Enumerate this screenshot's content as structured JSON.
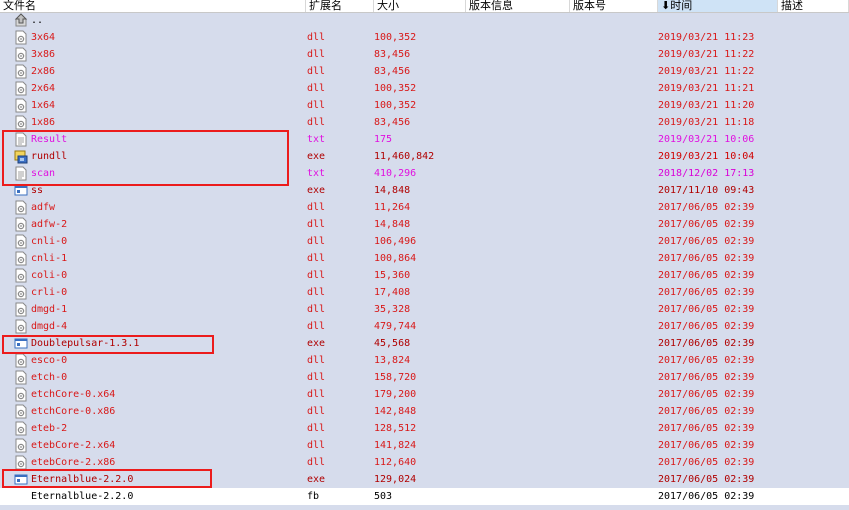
{
  "columns": {
    "name": "文件名",
    "ext": "扩展名",
    "size": "大小",
    "verinfo": "版本信息",
    "version": "版本号",
    "time": "⬇时间",
    "desc": "描述"
  },
  "rows": [
    {
      "name": "..",
      "ext": "",
      "size": "",
      "date": "",
      "type": "up",
      "icon": "up-folder-icon"
    },
    {
      "name": "3x64",
      "ext": "dll",
      "size": "100,352",
      "date": "2019/03/21 11:23",
      "type": "dll",
      "icon": "dll-file-icon"
    },
    {
      "name": "3x86",
      "ext": "dll",
      "size": "83,456",
      "date": "2019/03/21 11:22",
      "type": "dll",
      "icon": "dll-file-icon"
    },
    {
      "name": "2x86",
      "ext": "dll",
      "size": "83,456",
      "date": "2019/03/21 11:22",
      "type": "dll",
      "icon": "dll-file-icon"
    },
    {
      "name": "2x64",
      "ext": "dll",
      "size": "100,352",
      "date": "2019/03/21 11:21",
      "type": "dll",
      "icon": "dll-file-icon"
    },
    {
      "name": "1x64",
      "ext": "dll",
      "size": "100,352",
      "date": "2019/03/21 11:20",
      "type": "dll",
      "icon": "dll-file-icon"
    },
    {
      "name": "1x86",
      "ext": "dll",
      "size": "83,456",
      "date": "2019/03/21 11:18",
      "type": "dll",
      "icon": "dll-file-icon"
    },
    {
      "name": "Result",
      "ext": "txt",
      "size": "175",
      "date": "2019/03/21 10:06",
      "type": "txt",
      "icon": "text-file-icon"
    },
    {
      "name": "rundll",
      "ext": "exe",
      "size": "11,460,842",
      "date": "2019/03/21 10:04",
      "type": "exe-recent",
      "icon": "package-exe-icon"
    },
    {
      "name": "scan",
      "ext": "txt",
      "size": "410,296",
      "date": "2018/12/02 17:13",
      "type": "txt",
      "icon": "text-file-icon"
    },
    {
      "name": "ss",
      "ext": "exe",
      "size": "14,848",
      "date": "2017/11/10 09:43",
      "type": "exe",
      "icon": "exe-window-icon"
    },
    {
      "name": "adfw",
      "ext": "dll",
      "size": "11,264",
      "date": "2017/06/05 02:39",
      "type": "dll",
      "icon": "dll-file-icon"
    },
    {
      "name": "adfw-2",
      "ext": "dll",
      "size": "14,848",
      "date": "2017/06/05 02:39",
      "type": "dll",
      "icon": "dll-file-icon"
    },
    {
      "name": "cnli-0",
      "ext": "dll",
      "size": "106,496",
      "date": "2017/06/05 02:39",
      "type": "dll",
      "icon": "dll-file-icon"
    },
    {
      "name": "cnli-1",
      "ext": "dll",
      "size": "100,864",
      "date": "2017/06/05 02:39",
      "type": "dll",
      "icon": "dll-file-icon"
    },
    {
      "name": "coli-0",
      "ext": "dll",
      "size": "15,360",
      "date": "2017/06/05 02:39",
      "type": "dll",
      "icon": "dll-file-icon"
    },
    {
      "name": "crli-0",
      "ext": "dll",
      "size": "17,408",
      "date": "2017/06/05 02:39",
      "type": "dll",
      "icon": "dll-file-icon"
    },
    {
      "name": "dmgd-1",
      "ext": "dll",
      "size": "35,328",
      "date": "2017/06/05 02:39",
      "type": "dll",
      "icon": "dll-file-icon"
    },
    {
      "name": "dmgd-4",
      "ext": "dll",
      "size": "479,744",
      "date": "2017/06/05 02:39",
      "type": "dll",
      "icon": "dll-file-icon"
    },
    {
      "name": "Doublepulsar-1.3.1",
      "ext": "exe",
      "size": "45,568",
      "date": "2017/06/05 02:39",
      "type": "exe",
      "icon": "exe-window-icon"
    },
    {
      "name": "esco-0",
      "ext": "dll",
      "size": "13,824",
      "date": "2017/06/05 02:39",
      "type": "dll",
      "icon": "dll-file-icon"
    },
    {
      "name": "etch-0",
      "ext": "dll",
      "size": "158,720",
      "date": "2017/06/05 02:39",
      "type": "dll",
      "icon": "dll-file-icon"
    },
    {
      "name": "etchCore-0.x64",
      "ext": "dll",
      "size": "179,200",
      "date": "2017/06/05 02:39",
      "type": "dll",
      "icon": "dll-file-icon"
    },
    {
      "name": "etchCore-0.x86",
      "ext": "dll",
      "size": "142,848",
      "date": "2017/06/05 02:39",
      "type": "dll",
      "icon": "dll-file-icon"
    },
    {
      "name": "eteb-2",
      "ext": "dll",
      "size": "128,512",
      "date": "2017/06/05 02:39",
      "type": "dll",
      "icon": "dll-file-icon"
    },
    {
      "name": "etebCore-2.x64",
      "ext": "dll",
      "size": "141,824",
      "date": "2017/06/05 02:39",
      "type": "dll",
      "icon": "dll-file-icon"
    },
    {
      "name": "etebCore-2.x86",
      "ext": "dll",
      "size": "112,640",
      "date": "2017/06/05 02:39",
      "type": "dll",
      "icon": "dll-file-icon"
    },
    {
      "name": "Eternalblue-2.2.0",
      "ext": "exe",
      "size": "129,024",
      "date": "2017/06/05 02:39",
      "type": "exe",
      "icon": "exe-window-icon"
    },
    {
      "name": "Eternalblue-2.2.0",
      "ext": "fb",
      "size": "503",
      "date": "2017/06/05 02:39",
      "type": "plain",
      "icon": "blank-file-icon"
    }
  ]
}
